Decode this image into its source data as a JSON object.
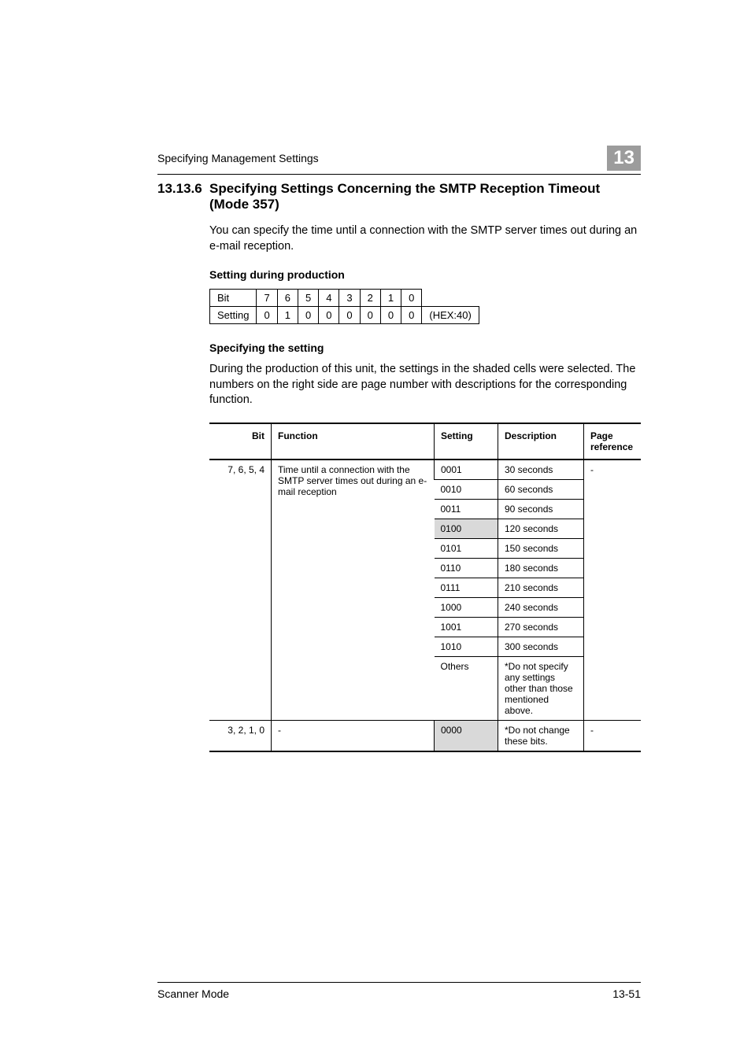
{
  "header": {
    "running_title": "Specifying Management Settings",
    "chapter_badge": "13"
  },
  "section": {
    "number": "13.13.6",
    "title": "Specifying Settings Concerning the SMTP Reception Timeout (Mode 357)",
    "intro": "You can specify the time until a connection with the SMTP server times out during an e-mail reception."
  },
  "production": {
    "heading": "Setting during production",
    "row_labels": [
      "Bit",
      "Setting"
    ],
    "bit_headers": [
      "7",
      "6",
      "5",
      "4",
      "3",
      "2",
      "1",
      "0"
    ],
    "setting_values": [
      "0",
      "1",
      "0",
      "0",
      "0",
      "0",
      "0",
      "0"
    ],
    "hex": "(HEX:40)"
  },
  "specifying": {
    "heading": "Specifying the setting",
    "intro": "During the production of this unit, the settings in the shaded cells were selected. The numbers on the right side are page number with descriptions for the corresponding function."
  },
  "mode_table": {
    "headers": {
      "bit": "Bit",
      "function": "Function",
      "setting": "Setting",
      "description": "Description",
      "reference": "Page reference"
    },
    "group1": {
      "bit": "7, 6, 5, 4",
      "function": "Time until a connection with the SMTP server times out during an e-mail reception",
      "ref": "-",
      "rows": [
        {
          "setting": "0001",
          "description": "30 seconds",
          "shaded": false
        },
        {
          "setting": "0010",
          "description": "60 seconds",
          "shaded": false
        },
        {
          "setting": "0011",
          "description": "90 seconds",
          "shaded": false
        },
        {
          "setting": "0100",
          "description": "120 seconds",
          "shaded": true
        },
        {
          "setting": "0101",
          "description": "150 seconds",
          "shaded": false
        },
        {
          "setting": "0110",
          "description": "180 seconds",
          "shaded": false
        },
        {
          "setting": "0111",
          "description": "210 seconds",
          "shaded": false
        },
        {
          "setting": "1000",
          "description": "240 seconds",
          "shaded": false
        },
        {
          "setting": "1001",
          "description": "270 seconds",
          "shaded": false
        },
        {
          "setting": "1010",
          "description": "300 seconds",
          "shaded": false
        },
        {
          "setting": "Others",
          "description": "*Do not specify any settings other than those mentioned above.",
          "shaded": false
        }
      ]
    },
    "group2": {
      "bit": "3, 2, 1, 0",
      "function": "-",
      "setting": "0000",
      "description": "*Do not change these bits.",
      "ref": "-"
    }
  },
  "footer": {
    "left": "Scanner Mode",
    "right": "13-51"
  }
}
